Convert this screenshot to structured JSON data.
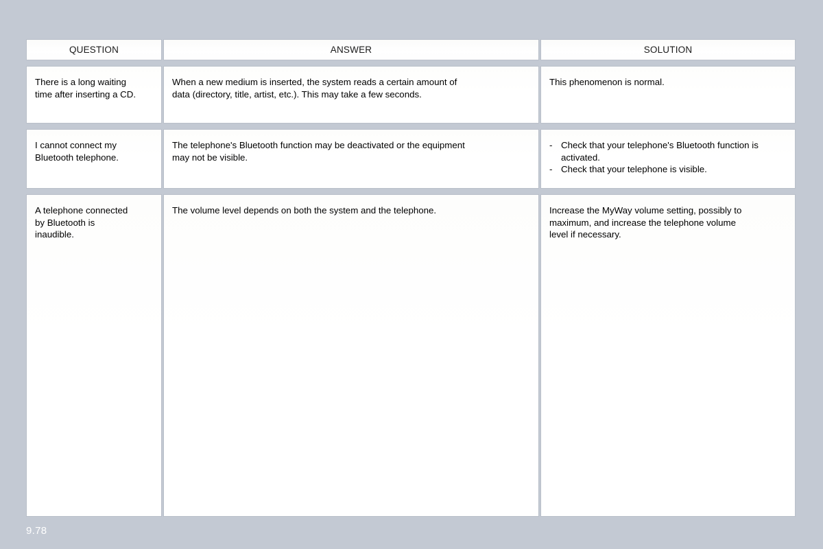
{
  "page": {
    "number": "9.78",
    "background_color": "#c3c9d3",
    "cell_color": "#ffffff",
    "border_color": "#b9bfc9",
    "text_color": "#000000"
  },
  "table": {
    "headers": {
      "question": "QUESTION",
      "answer": "ANSWER",
      "solution": "SOLUTION"
    },
    "rows": [
      {
        "question": "There is a long waiting\ntime after inserting a CD.",
        "answer": "When a new medium is inserted, the system reads a certain amount of\ndata (directory, title, artist, etc.). This may take a few seconds.",
        "solution": "This phenomenon is normal.",
        "solution_items": []
      },
      {
        "question": "I cannot connect my\nBluetooth telephone.",
        "answer": "The telephone's Bluetooth function may be deactivated or the equipment\nmay not be visible.",
        "solution": "",
        "solution_items": [
          {
            "marker": "-",
            "text": "Check that your telephone's Bluetooth function is activated."
          },
          {
            "marker": "-",
            "text": "Check that your telephone is visible."
          }
        ]
      },
      {
        "question": "A telephone connected\nby Bluetooth is\ninaudible.",
        "answer": "The volume level depends on both the system and the telephone.",
        "solution": "Increase the MyWay volume setting, possibly to\nmaximum, and increase the telephone volume\nlevel if necessary.",
        "solution_items": []
      }
    ]
  }
}
